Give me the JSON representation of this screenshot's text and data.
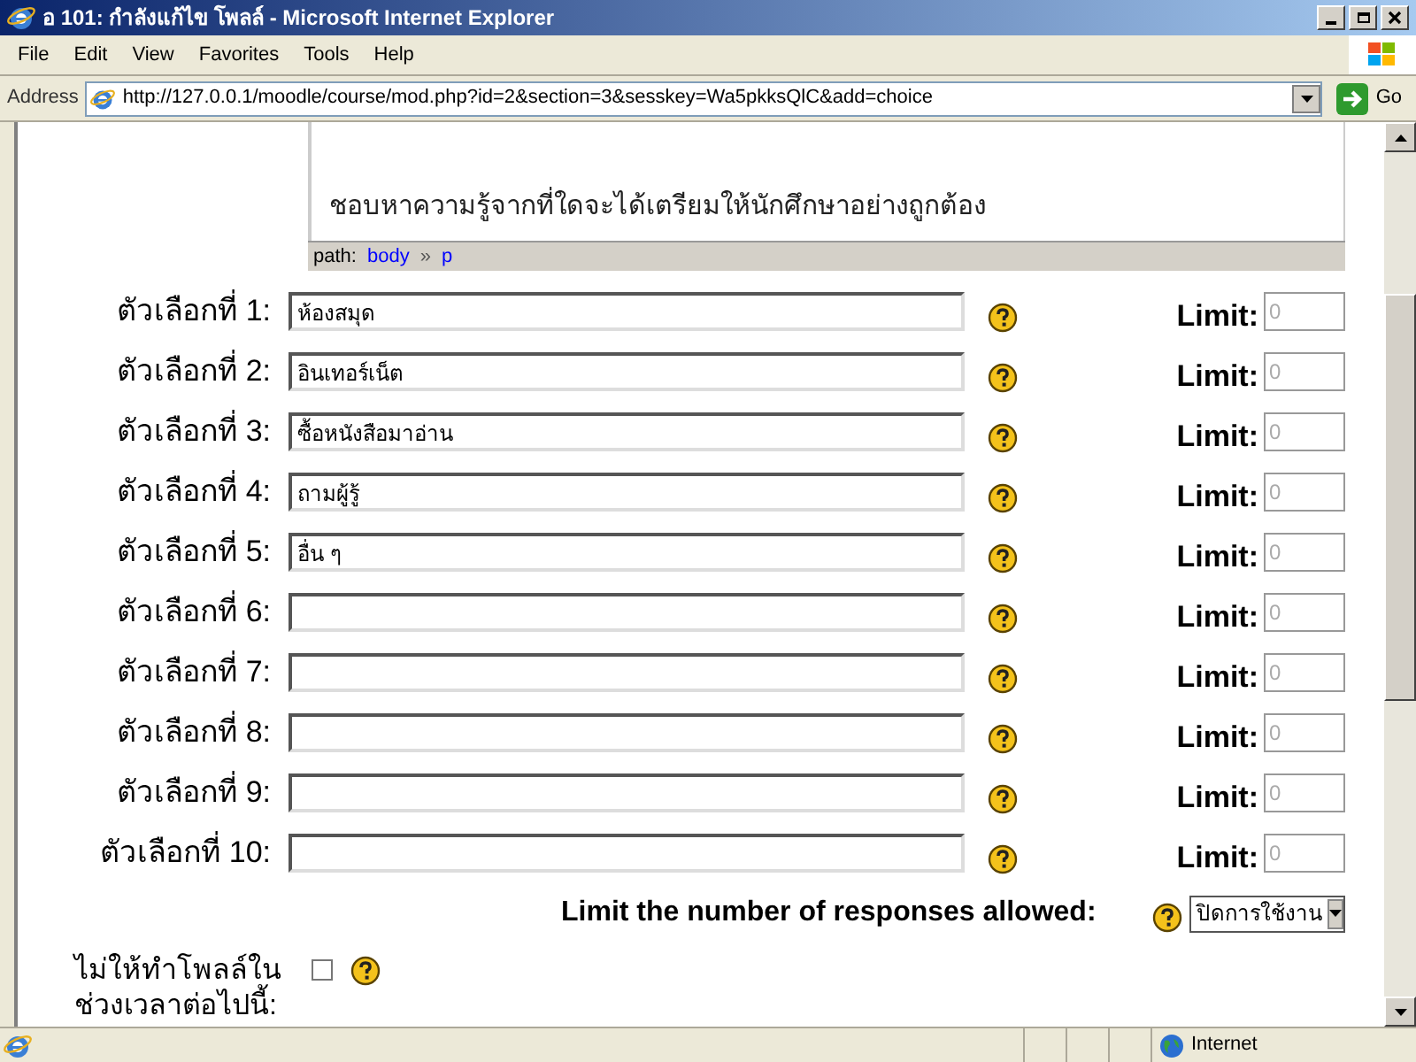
{
  "window": {
    "title": "อ 101: กำลังแก้ไข โพลล์ - Microsoft Internet Explorer"
  },
  "menu": [
    "File",
    "Edit",
    "View",
    "Favorites",
    "Tools",
    "Help"
  ],
  "address": {
    "label": "Address",
    "value": "http://127.0.0.1/moodle/course/mod.php?id=2&section=3&sesskey=Wa5pkksQlC&add=choice",
    "go": "Go"
  },
  "editor": {
    "text": "ชอบหาความรู้จากที่ใดจะได้เตรียมให้นักศึกษาอย่างถูกต้อง",
    "path_label": "path:",
    "path": [
      "body",
      "p"
    ],
    "path_separator": "»"
  },
  "options": [
    {
      "label": "ตัวเลือกที่ 1:",
      "value": "ห้องสมุด",
      "limit_label": "Limit:",
      "limit": "0",
      "limit_disabled": true
    },
    {
      "label": "ตัวเลือกที่ 2:",
      "value": "อินเทอร์เน็ต",
      "limit_label": "Limit:",
      "limit": "0",
      "limit_disabled": true
    },
    {
      "label": "ตัวเลือกที่ 3:",
      "value": "ซื้อหนังสือมาอ่าน",
      "limit_label": "Limit:",
      "limit": "0",
      "limit_disabled": true
    },
    {
      "label": "ตัวเลือกที่ 4:",
      "value": "ถามผู้รู้",
      "limit_label": "Limit:",
      "limit": "0",
      "limit_disabled": true
    },
    {
      "label": "ตัวเลือกที่ 5:",
      "value": "อื่น ๆ",
      "limit_label": "Limit:",
      "limit": "0",
      "limit_disabled": true
    },
    {
      "label": "ตัวเลือกที่ 6:",
      "limit_label": "Limit:",
      "limit": "0",
      "limit_disabled": true
    },
    {
      "label": "ตัวเลือกที่ 7:",
      "limit_label": "Limit:",
      "limit": "0",
      "limit_disabled": true
    },
    {
      "label": "ตัวเลือกที่ 8:",
      "limit_label": "Limit:",
      "limit": "0",
      "limit_disabled": true
    },
    {
      "label": "ตัวเลือกที่ 9:",
      "limit_label": "Limit:",
      "limit": "0",
      "limit_disabled": true
    },
    {
      "label": "ตัวเลือกที่ 10:",
      "limit_label": "Limit:",
      "limit": "0",
      "limit_disabled": true
    }
  ],
  "limit_responses": {
    "label": "Limit the number of responses allowed:",
    "value": "ปิดการใช้งาน"
  },
  "restrict_time": {
    "label": "ไม่ให้ทำโพลล์ในช่วงเวลาต่อไปนี้:",
    "checked": false
  },
  "status_bar": {
    "zone": "Internet"
  }
}
